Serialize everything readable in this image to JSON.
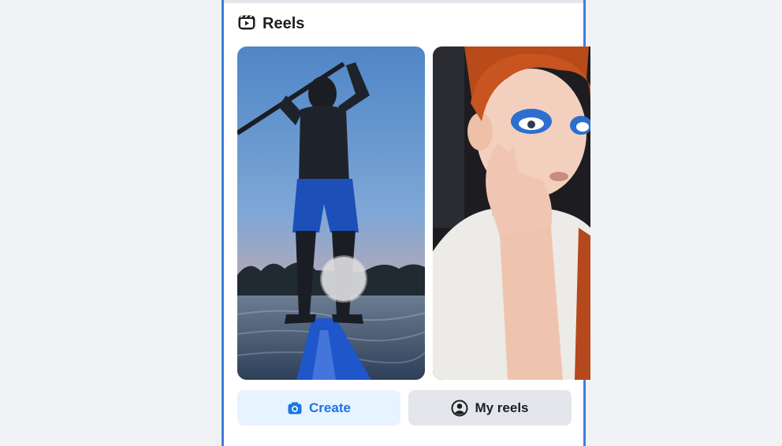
{
  "section": {
    "title": "Reels",
    "icon": "reels-icon"
  },
  "reels": [
    {
      "subject": "paddleboarder silhouette at sunset",
      "icon": "play-icon"
    },
    {
      "subject": "person applying blue eye makeup"
    }
  ],
  "actions": {
    "create_label": "Create",
    "create_icon": "camera-icon",
    "my_reels_label": "My reels",
    "my_reels_icon": "profile-icon"
  },
  "colors": {
    "accent": "#1b74e4",
    "create_bg": "#e7f3ff",
    "secondary_bg": "#e4e6eb",
    "frame_border": "#3b7fe0"
  }
}
